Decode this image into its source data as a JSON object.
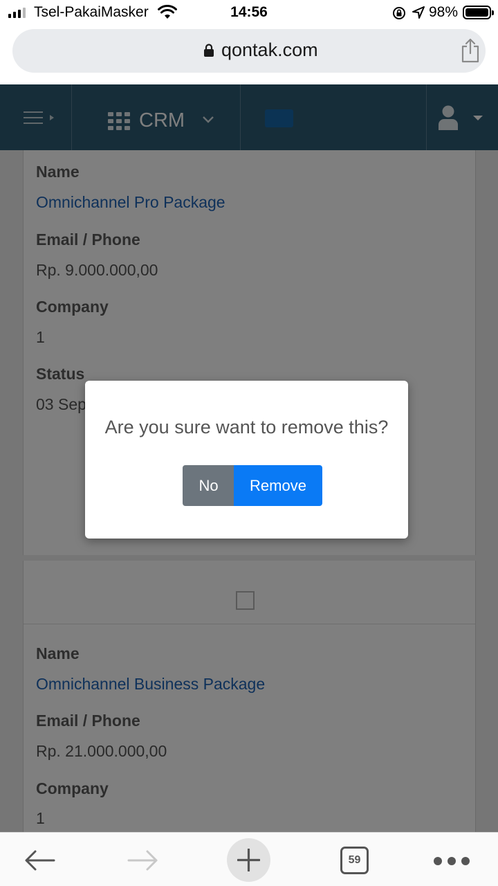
{
  "status_bar": {
    "carrier": "Tsel-PakaiMasker",
    "time": "14:56",
    "battery": "98%"
  },
  "browser": {
    "url": "qontak.com",
    "open_tabs": "59"
  },
  "header": {
    "module": "CRM",
    "icons": {
      "menu": "hamburger-icon",
      "apps": "grid-icon",
      "user": "user-icon"
    },
    "colors": {
      "header_bg": "#2c5a73",
      "flag": "#1666a8"
    }
  },
  "records": [
    {
      "fields": [
        {
          "label": "Name",
          "value": "Omnichannel Pro Package"
        },
        {
          "label": "Email / Phone",
          "value": "Rp. 9.000.000,00"
        },
        {
          "label": "Company",
          "value": "1"
        },
        {
          "label": "Status",
          "value": "03 Sep"
        }
      ]
    },
    {
      "fields": [
        {
          "label": "Name",
          "value": "Omnichannel Business Package"
        },
        {
          "label": "Email / Phone",
          "value": "Rp. 21.000.000,00"
        },
        {
          "label": "Company",
          "value": "1"
        }
      ]
    }
  ],
  "dialog": {
    "message": "Are you sure want to remove this?",
    "no_label": "No",
    "remove_label": "Remove",
    "colors": {
      "no": "#6c757d",
      "remove": "#0a7af5"
    }
  }
}
